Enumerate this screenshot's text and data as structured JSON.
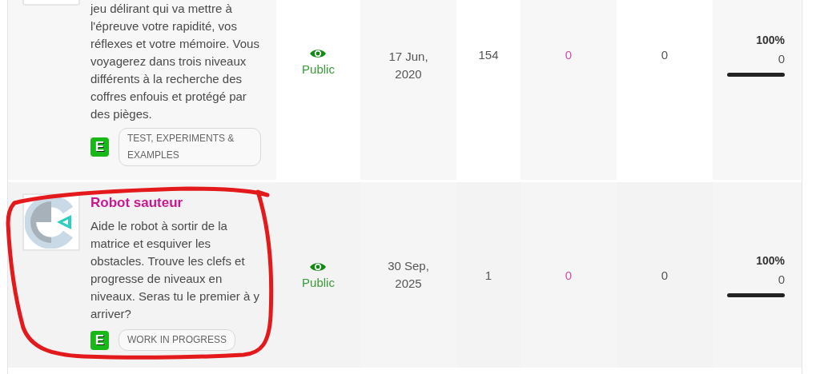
{
  "rows": [
    {
      "project": {
        "thumbnail": {
          "kind": "partial"
        },
        "description": "jeu délirant qui va mettre à l'épreuve votre rapidité, vos réflexes et votre mémoire. Vous voyagerez dans trois niveaux différents à la recherche des coffres enfouis et protégé par des pièges.",
        "badge": "E",
        "tag": "TEST, EXPERIMENTS & EXAMPLES"
      },
      "visibility": "Public",
      "date": "17 Jun, 2020",
      "column_4": "154",
      "column_5": "0",
      "column_6": "0",
      "column_7": {
        "percent": "100%",
        "count": "0",
        "level": 1
      }
    },
    {
      "annotation": {
        "kind": "freehand-loop"
      },
      "project": {
        "thumbnail": {
          "kind": "logo"
        },
        "title": "Robot sauteur",
        "description": "Aide le robot à sortir de la matrice et esquiver les obstacles. Trouve les clefs et progresse de niveaux en niveaux. Seras tu le premier à y arriver?",
        "badge": "E",
        "tag": "WORK IN PROGRESS"
      },
      "visibility": "Public",
      "date": "30 Sep, 2025",
      "column_4": "1",
      "column_5": "0",
      "column_6": "0",
      "column_7": {
        "percent": "100%",
        "count": "0",
        "level": 1
      }
    }
  ]
}
